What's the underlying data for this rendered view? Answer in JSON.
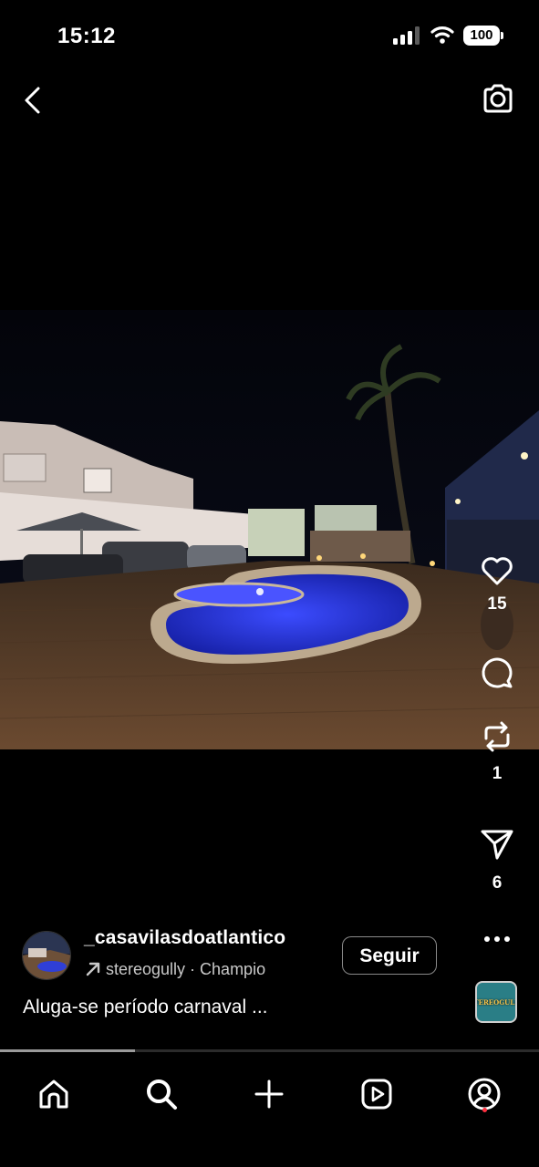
{
  "status_bar": {
    "time": "15:12",
    "battery": "100"
  },
  "post": {
    "username": "_casavilasdoatlantico",
    "audio": "stereogully · Champio",
    "follow_label": "Seguir",
    "caption": "Aluga-se período carnaval ...",
    "music_thumb_text": "STEREOGULLY"
  },
  "actions": {
    "likes": "15",
    "reposts": "1",
    "shares": "6"
  },
  "video_progress": 0.25,
  "icons": {
    "back": "chevron-left-icon",
    "camera": "camera-icon",
    "like": "heart-icon",
    "comment": "comment-icon",
    "repost": "repost-icon",
    "share": "send-icon",
    "more": "more-icon",
    "nav": [
      "home-icon",
      "search-icon",
      "plus-icon",
      "reels-icon",
      "profile-icon"
    ]
  },
  "colors": {
    "background": "#000000",
    "pool": "#2331c9",
    "notification": "#ff3040"
  }
}
